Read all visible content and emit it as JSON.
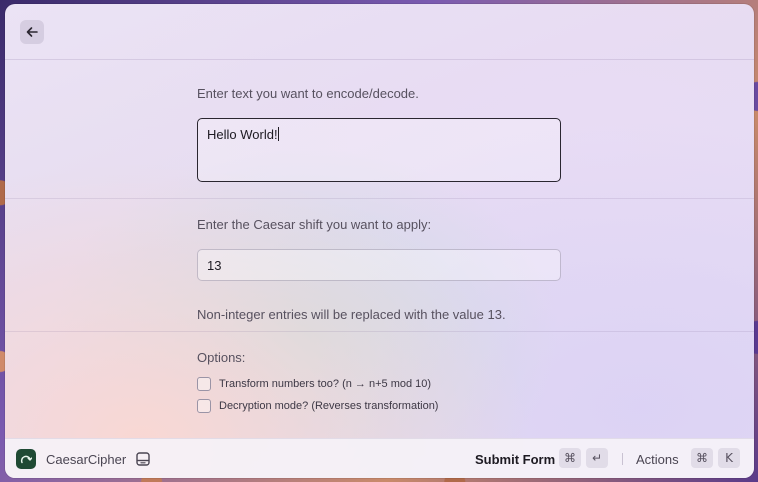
{
  "form": {
    "text_label": "Enter text you want to encode/decode.",
    "text_value": "Hello World!",
    "shift_label": "Enter the Caesar shift you want to apply:",
    "shift_value": "13",
    "shift_hint": "Non-integer entries will be replaced with the value 13.",
    "options_label": "Options:",
    "options": [
      {
        "label": "Transform numbers too? (n → n+5 mod 10)",
        "checked": false
      },
      {
        "label": "Decryption mode? (Reverses transformation)",
        "checked": false
      }
    ]
  },
  "footer": {
    "app_name": "CaesarCipher",
    "submit_label": "Submit Form",
    "submit_keys": [
      "⌘",
      "↵"
    ],
    "actions_label": "Actions",
    "actions_keys": [
      "⌘",
      "K"
    ]
  },
  "icons": {
    "back": "arrow-left-icon",
    "app": "caesar-cipher-app-icon",
    "layout": "panel-layout-icon"
  },
  "colors": {
    "app_icon_bg": "#1f4a34",
    "text_primary": "#1d1a22",
    "text_secondary": "#57515f"
  }
}
